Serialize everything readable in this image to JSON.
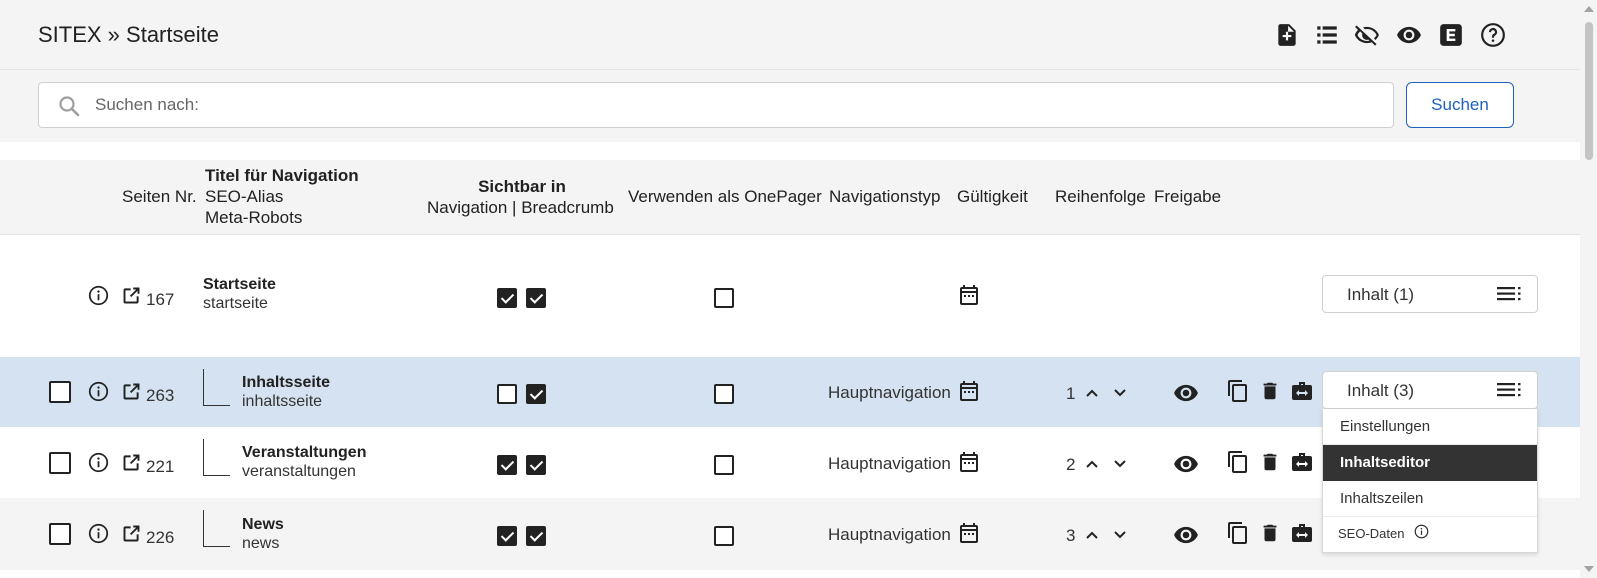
{
  "header": {
    "title": "SITEX » Startseite"
  },
  "search": {
    "placeholder": "Suchen nach:",
    "value": "",
    "button": "Suchen"
  },
  "columns": {
    "seiten_nr": "Seiten Nr.",
    "titel_nav": "Titel für Navigation",
    "seo_alias": "SEO-Alias",
    "meta_robots": "Meta-Robots",
    "sichtbar": "Sichtbar in",
    "nav_breadcrumb": "Navigation | Breadcrumb",
    "onepager": "Verwenden als OnePager",
    "navtyp": "Navigationstyp",
    "gueltigkeit": "Gültigkeit",
    "reihenfolge": "Reihenfolge",
    "freigabe": "Freigabe"
  },
  "rows": [
    {
      "nr": "167",
      "title": "Startseite",
      "alias": "startseite",
      "nav": true,
      "breadcrumb": true,
      "onepager": false,
      "navtype": "",
      "order": "",
      "inhalt": "Inhalt (1)",
      "selected": false,
      "highlight": false
    },
    {
      "nr": "263",
      "title": "Inhaltsseite",
      "alias": "inhaltsseite",
      "nav": false,
      "breadcrumb": true,
      "onepager": false,
      "navtype": "Hauptnavigation",
      "order": "1",
      "inhalt": "Inhalt (3)",
      "selected": false,
      "highlight": true
    },
    {
      "nr": "221",
      "title": "Veranstaltungen",
      "alias": "veranstaltungen",
      "nav": true,
      "breadcrumb": true,
      "onepager": false,
      "navtype": "Hauptnavigation",
      "order": "2",
      "inhalt": "",
      "selected": false,
      "highlight": false
    },
    {
      "nr": "226",
      "title": "News",
      "alias": "news",
      "nav": true,
      "breadcrumb": true,
      "onepager": false,
      "navtype": "Hauptnavigation",
      "order": "3",
      "inhalt": "",
      "selected": false,
      "highlight": false
    }
  ],
  "dropdown": {
    "items": [
      "Einstellungen",
      "Inhaltseditor",
      "Inhaltszeilen",
      "SEO-Daten"
    ],
    "active": "Inhaltseditor"
  },
  "colors": {
    "accent": "#1f5fbf",
    "row_highlight": "#d4e2f1",
    "row_alt": "#f4f4f4",
    "menu_active": "#333333"
  },
  "icons": {
    "header": [
      "new-page-icon",
      "list-icon",
      "eye-off-icon",
      "eye-icon",
      "e-icon",
      "help-icon"
    ],
    "row": [
      "info-icon",
      "external-link-icon",
      "calendar-icon",
      "chevron-up-icon",
      "chevron-down-icon",
      "eye-icon",
      "copy-icon",
      "trash-icon",
      "move-icon",
      "menu-icon"
    ]
  }
}
